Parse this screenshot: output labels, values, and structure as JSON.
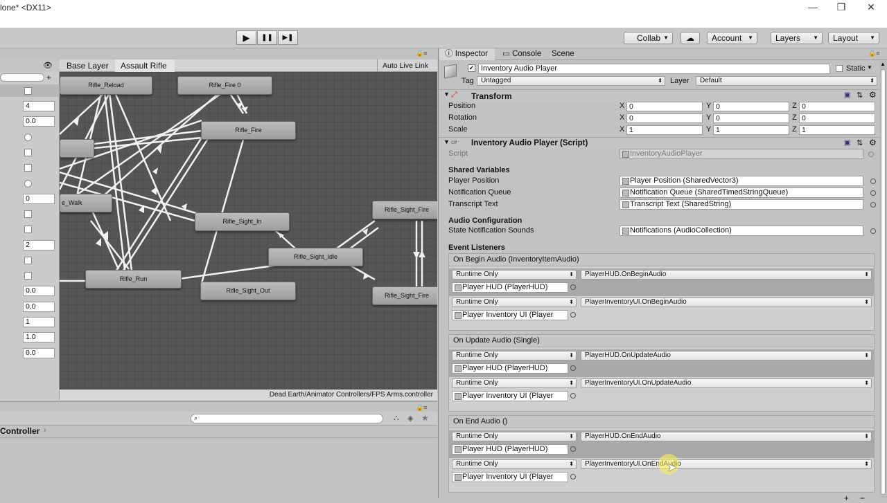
{
  "window": {
    "title": "lone* <DX11>",
    "min": "—",
    "restore": "❐",
    "close": "✕"
  },
  "toolbar": {
    "play": "▶",
    "pause": "❚❚",
    "step": "▶❚",
    "collab": "Collab",
    "cloud": "☁",
    "account": "Account",
    "layers": "Layers",
    "layout": "Layout"
  },
  "animator": {
    "breadcrumb": [
      "Base Layer",
      "Assault Rifle"
    ],
    "auto_live_link": "Auto Live Link",
    "nodes": [
      "Rifle_Reload",
      "Rifle_Fire 0",
      "Rifle_Fire",
      "e_Walk",
      "Rifle_Sight_In",
      "Rifle_Sight_Fire",
      "Rifle_Sight_Idle",
      "Rifle_Run",
      "Rifle_Sight_Out",
      "Rifle_Sight_Fire"
    ],
    "controller_path": "Dead Earth/Animator Controllers/FPS Arms.controller",
    "params": [
      "4",
      "0.0",
      "0",
      "2",
      "0.0",
      "0.0",
      "1",
      "1.0",
      "0.0"
    ]
  },
  "project": {
    "breadcrumb": "Controller"
  },
  "inspector": {
    "tabs": [
      "Inspector",
      "Console",
      "Scene"
    ],
    "object_name": "Inventory Audio Player",
    "static_label": "Static",
    "tag_label": "Tag",
    "tag_value": "Untagged",
    "layer_label": "Layer",
    "layer_value": "Default",
    "transform": {
      "title": "Transform",
      "rows": [
        {
          "label": "Position",
          "x": "0",
          "y": "0",
          "z": "0"
        },
        {
          "label": "Rotation",
          "x": "0",
          "y": "0",
          "z": "0"
        },
        {
          "label": "Scale",
          "x": "1",
          "y": "1",
          "z": "1"
        }
      ]
    },
    "script_component": {
      "title": "Inventory Audio Player (Script)",
      "script_label": "Script",
      "script_value": "InventoryAudioPlayer"
    },
    "shared_vars": {
      "header": "Shared Variables",
      "rows": [
        {
          "label": "Player Position",
          "value": "Player Position (SharedVector3)"
        },
        {
          "label": "Notification Queue",
          "value": "Notification Queue (SharedTimedStringQueue)"
        },
        {
          "label": "Transcript Text",
          "value": "Transcript Text (SharedString)"
        }
      ]
    },
    "audio_config": {
      "header": "Audio Configuration",
      "label": "State Notification Sounds",
      "value": "Notifications (AudioCollection)"
    },
    "event_header": "Event Listeners",
    "events": [
      {
        "title": "On Begin Audio (InventoryItemAudio)",
        "listeners": [
          {
            "mode": "Runtime Only",
            "function": "PlayerHUD.OnBeginAudio",
            "target": "Player HUD (PlayerHUD)"
          },
          {
            "mode": "Runtime Only",
            "function": "PlayerInventoryUI.OnBeginAudio",
            "target": "Player Inventory UI (Player"
          }
        ]
      },
      {
        "title": "On Update Audio (Single)",
        "listeners": [
          {
            "mode": "Runtime Only",
            "function": "PlayerHUD.OnUpdateAudio",
            "target": "Player HUD (PlayerHUD)"
          },
          {
            "mode": "Runtime Only",
            "function": "PlayerInventoryUI.OnUpdateAudio",
            "target": "Player Inventory UI (Player"
          }
        ]
      },
      {
        "title": "On End Audio ()",
        "listeners": [
          {
            "mode": "Runtime Only",
            "function": "PlayerHUD.OnEndAudio",
            "target": "Player HUD (PlayerHUD)"
          },
          {
            "mode": "Runtime Only",
            "function": "PlayerInventoryUI.OnEndAudio",
            "target": "Player Inventory UI (Player"
          }
        ]
      }
    ],
    "plus": "+",
    "minus": "−"
  }
}
